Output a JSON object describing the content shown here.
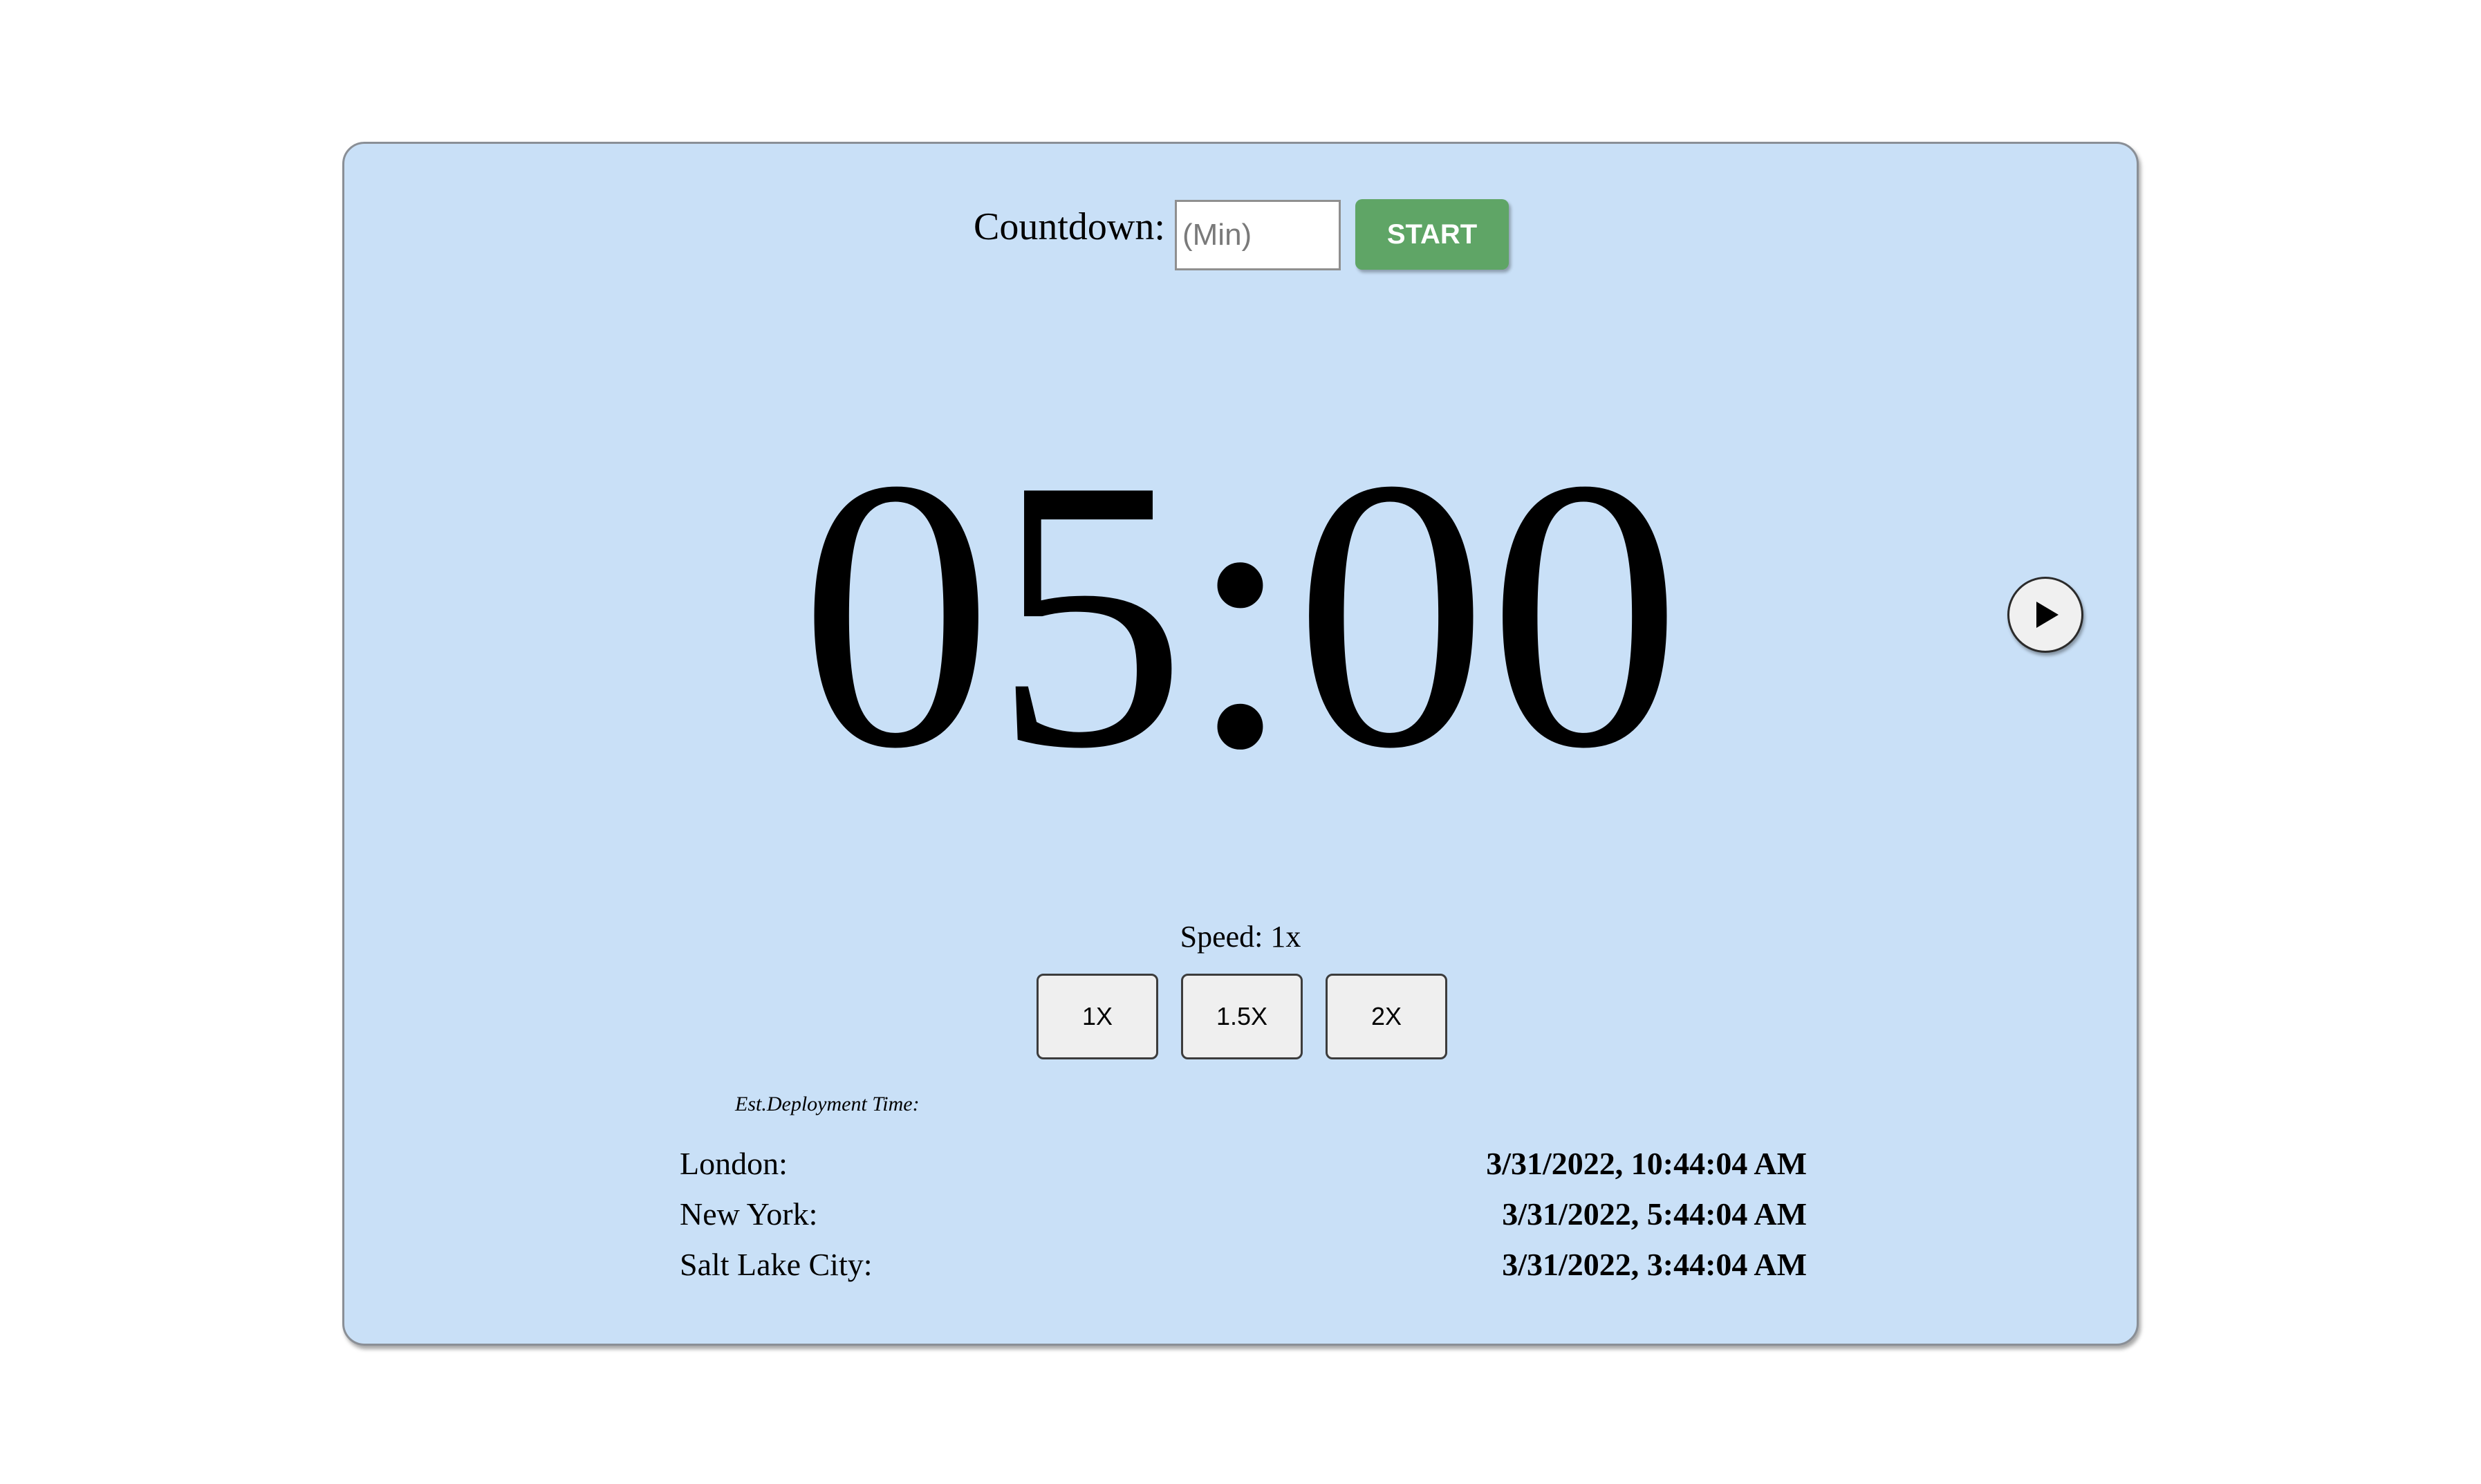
{
  "countdown": {
    "label": "Countdown:",
    "input_value": "",
    "input_placeholder": "(Min)",
    "start_label": "START"
  },
  "timer": {
    "display": "05:00"
  },
  "play_button": {
    "icon": "play-icon"
  },
  "speed": {
    "label": "Speed: 1x",
    "options": [
      "1X",
      "1.5X",
      "2X"
    ]
  },
  "deployment": {
    "heading": "Est.Deployment Time:",
    "rows": [
      {
        "city": "London:",
        "time": "3/31/2022, 10:44:04 AM"
      },
      {
        "city": "New York:",
        "time": "3/31/2022, 5:44:04 AM"
      },
      {
        "city": "Salt Lake City:",
        "time": "3/31/2022, 3:44:04 AM"
      }
    ]
  },
  "colors": {
    "panel_background": "#c9e0f7",
    "start_button": "#5fa566"
  }
}
